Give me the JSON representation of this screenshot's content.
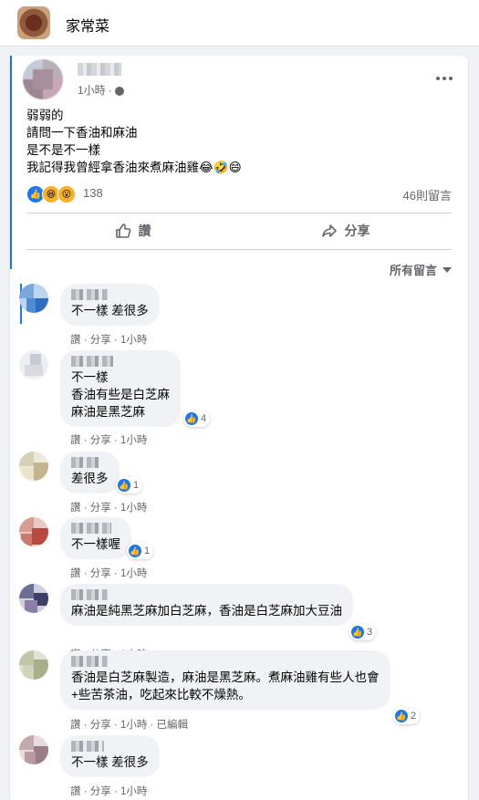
{
  "header": {
    "group_title": "家常菜"
  },
  "post": {
    "time": "1小時",
    "lines": [
      "弱弱的",
      "請問一下香油和麻油",
      "是不是不一樣",
      "我記得我曾經拿香油來煮麻油雞😂🤣😄"
    ],
    "reaction_count": "138",
    "comment_count": "46則留言",
    "like_label": "讚",
    "share_label": "分享",
    "sort_label": "所有留言"
  },
  "comments": [
    {
      "lines": [
        "不一樣 差很多"
      ],
      "likes": "",
      "meta": "讚 · 分享 · 1小時"
    },
    {
      "lines": [
        "不一樣",
        "香油有些是白芝麻",
        "麻油是黑芝麻"
      ],
      "likes": "4",
      "meta": "讚 · 分享 · 1小時"
    },
    {
      "lines": [
        "差很多"
      ],
      "likes": "1",
      "meta": "讚 · 分享 · 1小時"
    },
    {
      "lines": [
        "不一樣喔"
      ],
      "likes": "1",
      "meta": "讚 · 分享 · 1小時"
    },
    {
      "lines": [
        "麻油是純黑芝麻加白芝麻，香油是白芝麻加大豆油"
      ],
      "likes": "3",
      "meta": "讚 · 分享 · 1小時"
    },
    {
      "lines": [
        "香油是白芝麻製造，麻油是黑芝麻。煮麻油雞有些人也會",
        "+些苦茶油，吃起來比較不燥熱。"
      ],
      "likes": "2",
      "meta": "讚 · 分享 · 1小時 · 已編輯"
    },
    {
      "lines": [
        "不一樣 差很多"
      ],
      "likes": "",
      "meta": "讚 · 分享 · 1小時"
    }
  ]
}
